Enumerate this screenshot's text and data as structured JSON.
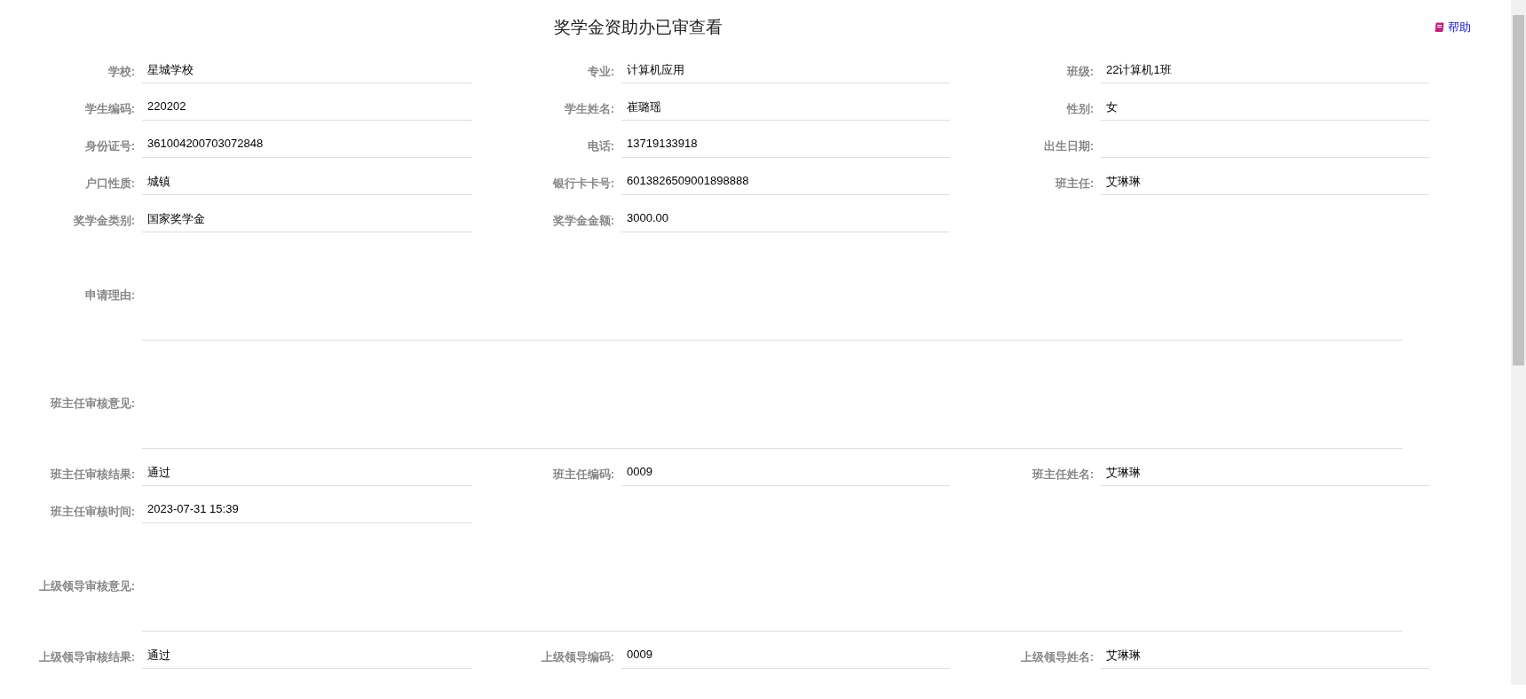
{
  "title": "奖学金资助办已审查看",
  "help_link": "帮助",
  "rows": [
    {
      "kind": "fields",
      "fields": [
        {
          "label": "学校:",
          "value": "星城学校"
        },
        {
          "label": "专业:",
          "value": "计算机应用"
        },
        {
          "label": "班级:",
          "value": "22计算机1班"
        }
      ]
    },
    {
      "kind": "fields",
      "fields": [
        {
          "label": "学生编码:",
          "value": "220202"
        },
        {
          "label": "学生姓名:",
          "value": "崔璐瑶"
        },
        {
          "label": "性别:",
          "value": "女"
        }
      ]
    },
    {
      "kind": "fields",
      "fields": [
        {
          "label": "身份证号:",
          "value": "361004200703072848"
        },
        {
          "label": "电话:",
          "value": "13719133918"
        },
        {
          "label": "出生日期:"
        }
      ]
    },
    {
      "kind": "fields",
      "fields": [
        {
          "label": "户口性质:",
          "value": "城镇"
        },
        {
          "label": "银行卡卡号:",
          "value": "6013826509001898888"
        },
        {
          "label": "班主任:",
          "value": "艾琳琳"
        }
      ]
    },
    {
      "kind": "fields",
      "fields": [
        {
          "label": "奖学金类别:",
          "value": "国家奖学金"
        },
        {
          "label": "奖学金金额:",
          "value": "3000.00"
        }
      ]
    },
    {
      "kind": "textarea",
      "label": "申请理由:"
    },
    {
      "kind": "textarea",
      "label": "班主任审核意见:"
    },
    {
      "kind": "fields",
      "fields": [
        {
          "label": "班主任审核结果:",
          "value": "通过"
        },
        {
          "label": "班主任编码:",
          "value": "0009"
        },
        {
          "label": "班主任姓名:",
          "value": "艾琳琳"
        }
      ]
    },
    {
      "kind": "fields",
      "fields": [
        {
          "label": "班主任审核时间:",
          "value": "2023-07-31 15:39"
        }
      ]
    },
    {
      "kind": "textarea",
      "label": "上级领导审核意见:"
    },
    {
      "kind": "fields",
      "fields": [
        {
          "label": "上级领导审核结果:",
          "value": "通过"
        },
        {
          "label": "上级领导编码:",
          "value": "0009"
        },
        {
          "label": "上级领导姓名:",
          "value": "艾琳琳"
        }
      ]
    }
  ]
}
